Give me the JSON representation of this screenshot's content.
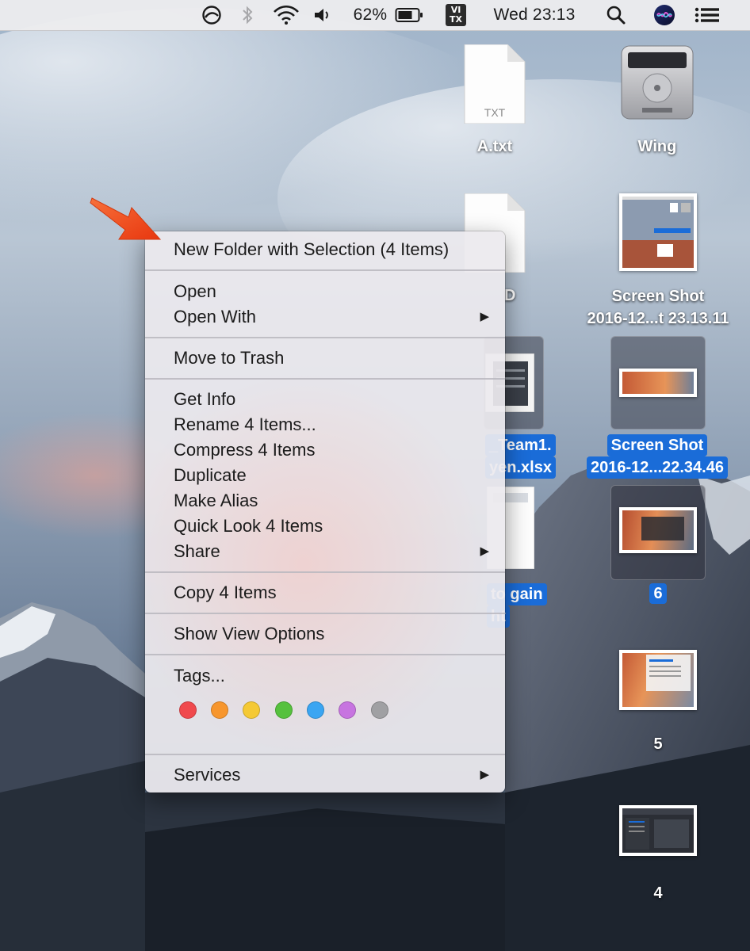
{
  "menubar": {
    "battery_percent": "62%",
    "input_badge_line1": "VI",
    "input_badge_line2": "TX",
    "clock": "Wed 23:13",
    "icons": [
      "focus-circle-icon",
      "bluetooth-icon",
      "wifi-icon",
      "volume-icon",
      "battery-icon",
      "search-icon",
      "siri-icon",
      "menu-list-icon"
    ]
  },
  "desktop": {
    "file_a_badge": "TXT",
    "file_a_name": "A.txt",
    "disk_name": "Wing",
    "partial_d_name": "D",
    "shot1_line1": "Screen Shot",
    "shot1_line2": "2016-12...t 23.13.11",
    "team_line1": "_Team1.",
    "team_line2": "yen.xlsx",
    "shot2_line1": "Screen Shot",
    "shot2_line2": "2016-12...22.34.46",
    "gain_line1": "to gain",
    "gain_line2": "ht",
    "thumb6_name": "6",
    "thumb5_name": "5",
    "thumb4_name": "4"
  },
  "context_menu": {
    "new_folder": "New Folder with Selection (4 Items)",
    "open": "Open",
    "open_with": "Open With",
    "move_to_trash": "Move to Trash",
    "get_info": "Get Info",
    "rename": "Rename 4 Items...",
    "compress": "Compress 4 Items",
    "duplicate": "Duplicate",
    "make_alias": "Make Alias",
    "quick_look": "Quick Look 4 Items",
    "share": "Share",
    "copy": "Copy 4 Items",
    "show_view_options": "Show View Options",
    "tags": "Tags...",
    "services": "Services",
    "submenu_arrow": "▶",
    "tag_colors": [
      "#f0494d",
      "#f7962d",
      "#f5c934",
      "#56c13d",
      "#3aa5f2",
      "#c774e0",
      "#a0a0a3"
    ]
  },
  "colors": {
    "selection_blue": "#1a6cd8",
    "annotation_arrow": "#f24a1c"
  }
}
